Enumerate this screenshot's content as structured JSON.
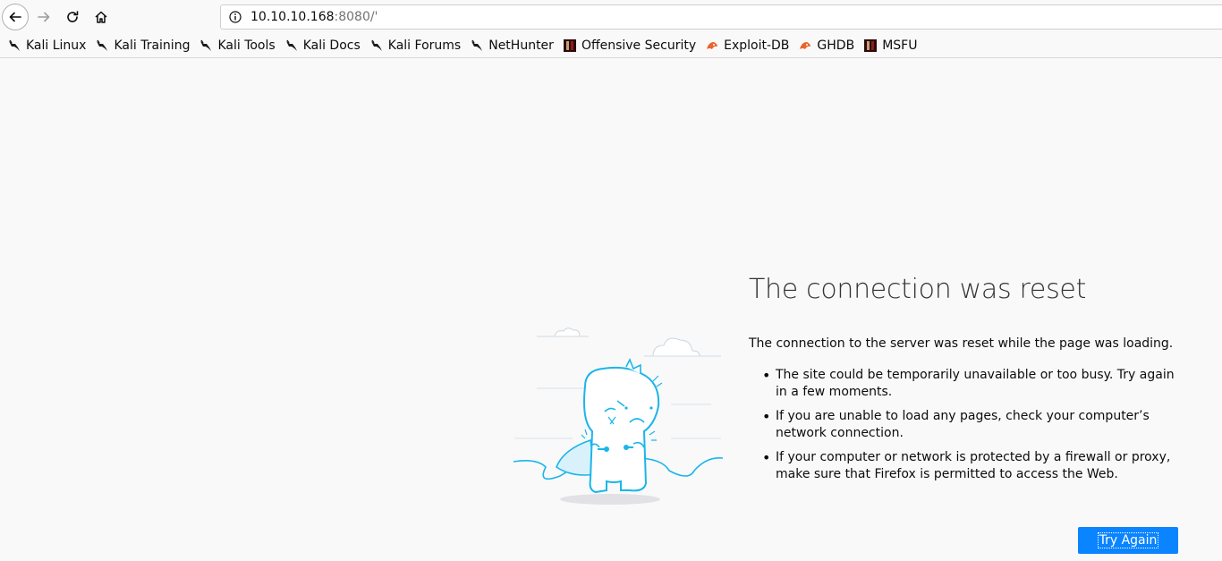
{
  "toolbar": {
    "url_host": "10.10.10.168",
    "url_rest": ":8080/'"
  },
  "bookmarks": [
    {
      "label": "Kali Linux",
      "icon": "kali-dragon-icon"
    },
    {
      "label": "Kali Training",
      "icon": "kali-dragon-icon"
    },
    {
      "label": "Kali Tools",
      "icon": "kali-dragon-icon"
    },
    {
      "label": "Kali Docs",
      "icon": "kali-dragon-icon"
    },
    {
      "label": "Kali Forums",
      "icon": "kali-dragon-icon"
    },
    {
      "label": "NetHunter",
      "icon": "kali-dragon-icon"
    },
    {
      "label": "Offensive Security",
      "icon": "offsec-icon"
    },
    {
      "label": "Exploit-DB",
      "icon": "exploit-db-icon"
    },
    {
      "label": "GHDB",
      "icon": "exploit-db-icon"
    },
    {
      "label": "MSFU",
      "icon": "offsec-icon"
    }
  ],
  "error": {
    "title": "The connection was reset",
    "description": "The connection to the server was reset while the page was loading.",
    "items": [
      "The site could be temporarily unavailable or too busy. Try again in a few moments.",
      "If you are unable to load any pages, check your computer’s network connection.",
      "If your computer or network is protected by a firewall or proxy, make sure that Firefox is permitted to access the Web."
    ],
    "button_label": "Try Again"
  },
  "colors": {
    "accent": "#0a84ff",
    "illustration": "#1ab6e8"
  }
}
